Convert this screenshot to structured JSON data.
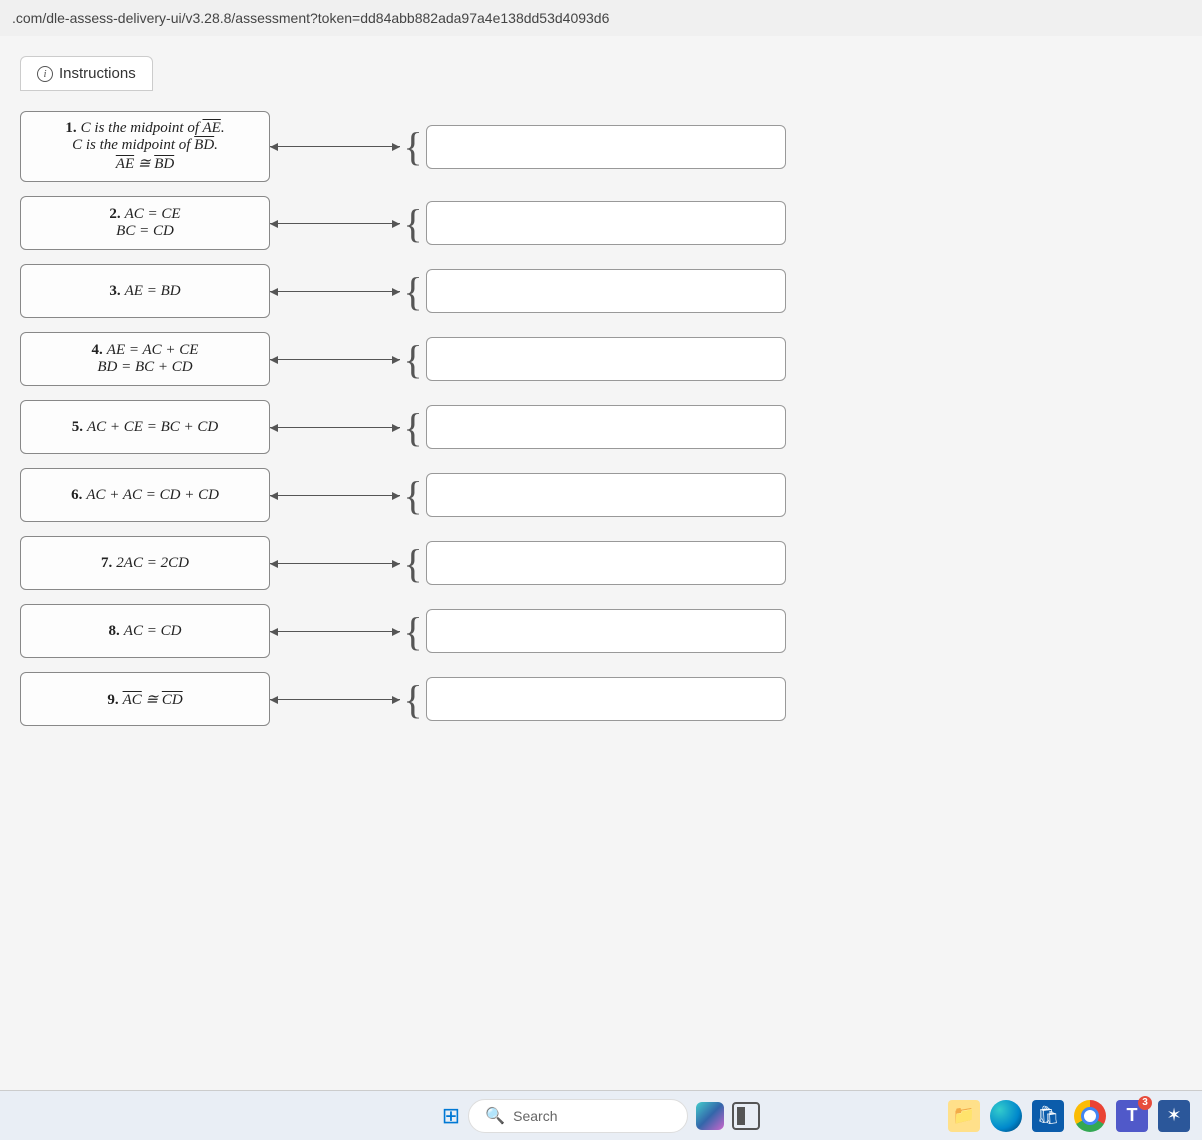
{
  "url": ".com/dle-assess-delivery-ui/v3.28.8/assessment?token=dd84abb882ada97a4e138dd53d4093d6",
  "instructions_label": "Instructions",
  "statements": [
    {
      "num": "1.",
      "lines": [
        "C is the midpoint of <ov>AE</ov>.",
        "C is the midpoint of <ov>BD</ov>.",
        "<ov>AE</ov> ≅ <ov>BD</ov>"
      ]
    },
    {
      "num": "2.",
      "lines": [
        "AC = CE",
        "BC = CD"
      ]
    },
    {
      "num": "3.",
      "lines": [
        "AE = BD"
      ]
    },
    {
      "num": "4.",
      "lines": [
        "AE = AC + CE",
        "BD = BC + CD"
      ]
    },
    {
      "num": "5.",
      "lines": [
        "AC + CE = BC + CD"
      ]
    },
    {
      "num": "6.",
      "lines": [
        "AC + AC = CD + CD"
      ]
    },
    {
      "num": "7.",
      "lines": [
        "2AC = 2CD"
      ]
    },
    {
      "num": "8.",
      "lines": [
        "AC = CD"
      ]
    },
    {
      "num": "9.",
      "lines": [
        "<ov>AC</ov> ≅ <ov>CD</ov>"
      ]
    }
  ],
  "search_placeholder": "Search",
  "teams_badge": "3",
  "teams_letter": "T"
}
